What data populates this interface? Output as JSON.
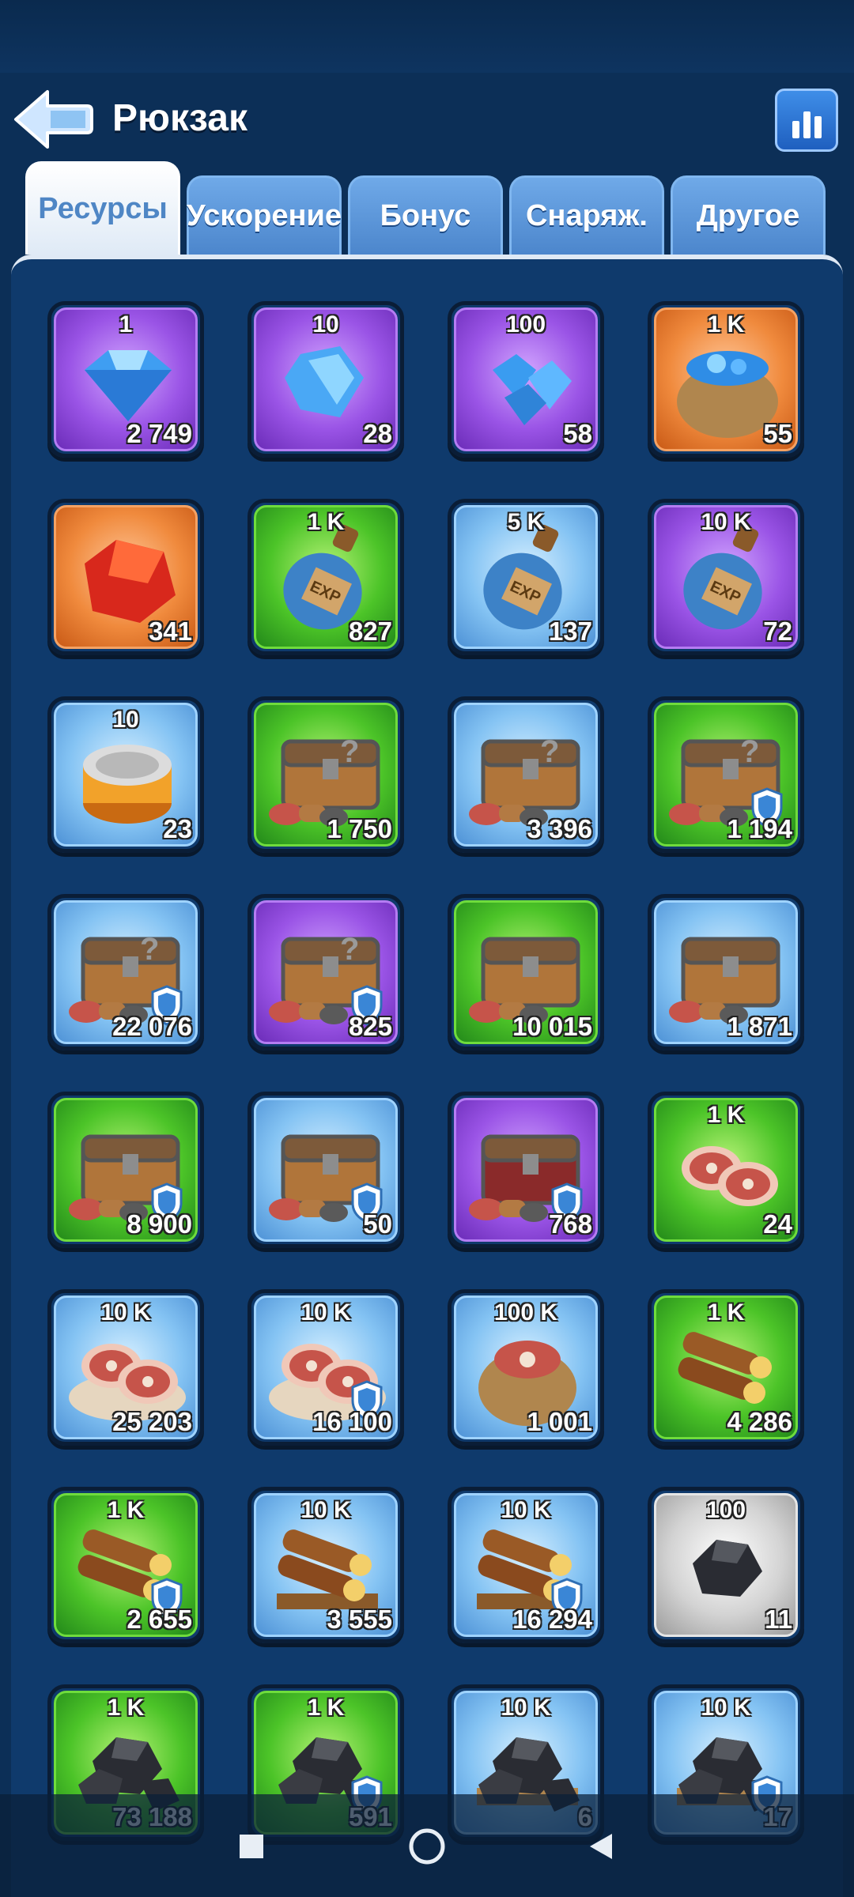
{
  "header": {
    "title": "Рюкзак"
  },
  "tabs": [
    {
      "label": "Ресурсы",
      "active": true
    },
    {
      "label": "Ускорение",
      "active": false
    },
    {
      "label": "Бонус",
      "active": false
    },
    {
      "label": "Снаряж.",
      "active": false
    },
    {
      "label": "Другое",
      "active": false
    }
  ],
  "items": [
    {
      "icon": "gem-icon",
      "rarity": "purple",
      "amount": "1",
      "count": "2 749"
    },
    {
      "icon": "gems-icon",
      "rarity": "purple",
      "amount": "10",
      "count": "28"
    },
    {
      "icon": "gem-pile-icon",
      "rarity": "purple",
      "amount": "100",
      "count": "58"
    },
    {
      "icon": "gem-sack-icon",
      "rarity": "orange",
      "amount": "1 K",
      "count": "55"
    },
    {
      "icon": "red-crystal-icon",
      "rarity": "orange",
      "amount": "",
      "count": "341"
    },
    {
      "icon": "exp-bottle-icon",
      "rarity": "green",
      "amount": "1 K",
      "count": "827"
    },
    {
      "icon": "exp-bottle-icon",
      "rarity": "blue",
      "amount": "5 K",
      "count": "137"
    },
    {
      "icon": "exp-bottle-icon",
      "rarity": "purple",
      "amount": "10 K",
      "count": "72"
    },
    {
      "icon": "tin-can-icon",
      "rarity": "blue",
      "amount": "10",
      "count": "23"
    },
    {
      "icon": "mystery-chest-icon",
      "rarity": "green",
      "amount": "",
      "count": "1 750"
    },
    {
      "icon": "mystery-chest-icon",
      "rarity": "blue",
      "amount": "",
      "count": "3 396"
    },
    {
      "icon": "mystery-chest-shield-icon",
      "rarity": "green",
      "amount": "",
      "count": "1 194"
    },
    {
      "icon": "mystery-chest-shield-icon",
      "rarity": "blue",
      "amount": "",
      "count": "22 076"
    },
    {
      "icon": "mystery-chest-shield-icon",
      "rarity": "purple",
      "amount": "",
      "count": "825"
    },
    {
      "icon": "resource-chest-icon",
      "rarity": "green",
      "amount": "",
      "count": "10 015"
    },
    {
      "icon": "resource-chest-icon",
      "rarity": "blue",
      "amount": "",
      "count": "1 871"
    },
    {
      "icon": "resource-chest-shield-icon",
      "rarity": "green",
      "amount": "",
      "count": "8 900"
    },
    {
      "icon": "resource-chest-shield-icon",
      "rarity": "blue",
      "amount": "",
      "count": "50"
    },
    {
      "icon": "elite-chest-shield-icon",
      "rarity": "purple",
      "amount": "",
      "count": "768"
    },
    {
      "icon": "meat-icon",
      "rarity": "green",
      "amount": "1 K",
      "count": "24"
    },
    {
      "icon": "meat-plate-icon",
      "rarity": "blue",
      "amount": "10 K",
      "count": "25 203"
    },
    {
      "icon": "meat-plate-shield-icon",
      "rarity": "blue",
      "amount": "10 K",
      "count": "16 100"
    },
    {
      "icon": "meat-sack-icon",
      "rarity": "blue",
      "amount": "100 K",
      "count": "1 001"
    },
    {
      "icon": "wood-icon",
      "rarity": "green",
      "amount": "1 K",
      "count": "4 286"
    },
    {
      "icon": "wood-shield-icon",
      "rarity": "green",
      "amount": "1 K",
      "count": "2 655"
    },
    {
      "icon": "wood-pallet-icon",
      "rarity": "blue",
      "amount": "10 K",
      "count": "3 555"
    },
    {
      "icon": "wood-pallet-shield-icon",
      "rarity": "blue",
      "amount": "10 K",
      "count": "16 294"
    },
    {
      "icon": "coal-icon",
      "rarity": "gray",
      "amount": "100",
      "count": "11"
    },
    {
      "icon": "coal-pile-icon",
      "rarity": "green",
      "amount": "1 K",
      "count": "73 188"
    },
    {
      "icon": "coal-pile-shield-icon",
      "rarity": "green",
      "amount": "1 K",
      "count": "591"
    },
    {
      "icon": "coal-pallet-icon",
      "rarity": "blue",
      "amount": "10 K",
      "count": "6"
    },
    {
      "icon": "coal-pallet-shield-icon",
      "rarity": "blue",
      "amount": "10 K",
      "count": "17"
    }
  ],
  "colors": {
    "background": "#0c2f57",
    "purple": "#9a54e6",
    "orange": "#f08a3d",
    "green": "#4cc428",
    "blue": "#84c3f3",
    "gray": "#d3d3d3"
  }
}
